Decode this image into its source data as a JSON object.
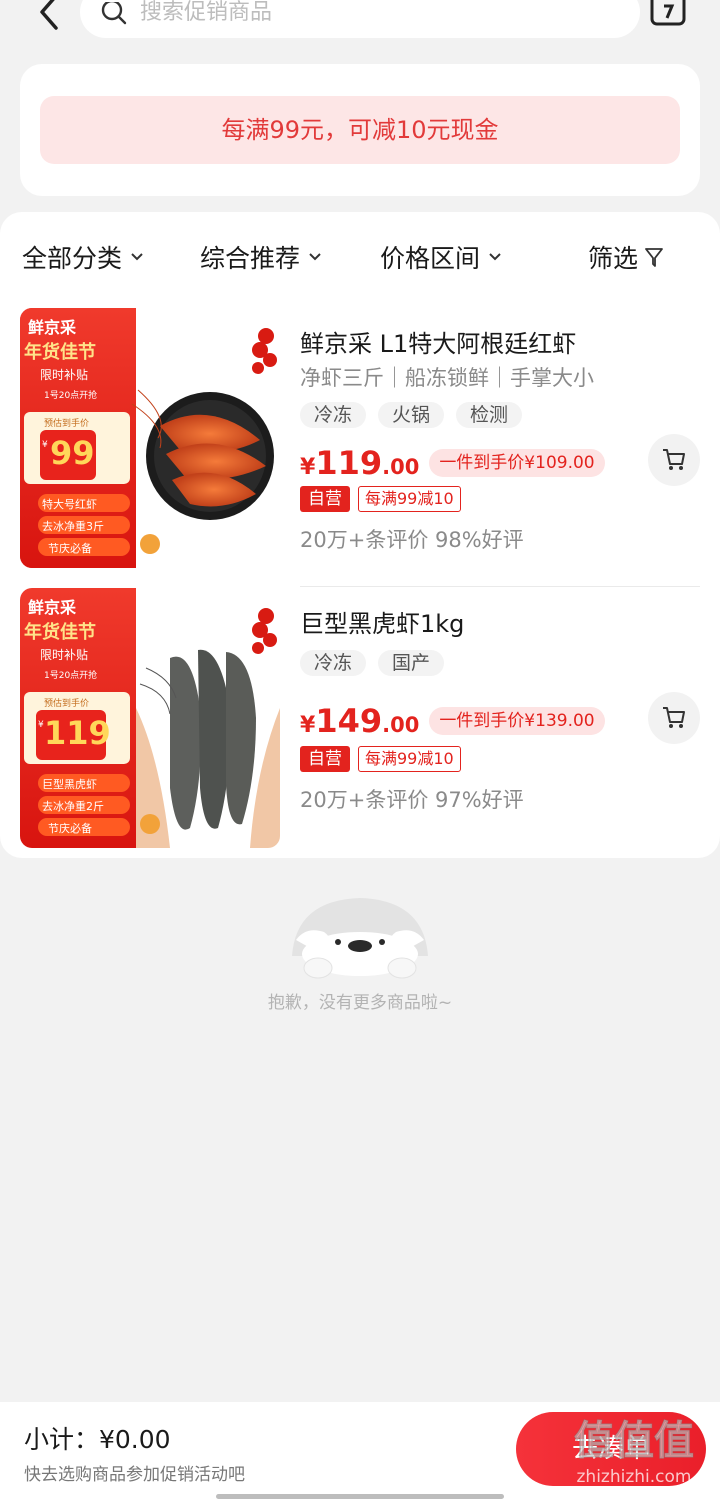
{
  "search": {
    "placeholder": "搜索促销商品"
  },
  "promo": {
    "text": "每满99元，可减10元现金"
  },
  "filters": [
    {
      "label": "全部分类",
      "icon": "chevron-down-icon"
    },
    {
      "label": "综合推荐",
      "icon": "chevron-down-icon"
    },
    {
      "label": "价格区间",
      "icon": "chevron-down-icon"
    },
    {
      "label": "筛选",
      "icon": "funnel-icon"
    }
  ],
  "products": [
    {
      "title": "鲜京采 L1特大阿根廷红虾",
      "subtitle": "净虾三斤｜船冻锁鲜｜手掌大小",
      "tags": [
        "冷冻",
        "火锅",
        "检测"
      ],
      "price_currency": "¥",
      "price_int": "119",
      "price_dec": ".00",
      "final_price": "一件到手价¥109.00",
      "badge_self": "自营",
      "badge_promo": "每满99减10",
      "reviews": "20万+条评价  98%好评",
      "thumb": {
        "brand": "鲜京采",
        "festival": "年货佳节",
        "subsidy": "限时补贴",
        "start": "1号20点开抢",
        "est_label": "预估到手价",
        "est_currency": "¥",
        "est_price": "99",
        "lines": [
          "特大号红虾",
          "去冰净重3斤",
          "节庆必备"
        ]
      }
    },
    {
      "title": "巨型黑虎虾1kg",
      "subtitle": "",
      "tags": [
        "冷冻",
        "国产"
      ],
      "price_currency": "¥",
      "price_int": "149",
      "price_dec": ".00",
      "final_price": "一件到手价¥139.00",
      "badge_self": "自营",
      "badge_promo": "每满99减10",
      "reviews": "20万+条评价  97%好评",
      "thumb": {
        "brand": "鲜京采",
        "festival": "年货佳节",
        "subsidy": "限时补贴",
        "start": "1号20点开抢",
        "est_label": "预估到手价",
        "est_currency": "¥",
        "est_price": "119",
        "lines": [
          "巨型黑虎虾",
          "去冰净重2斤",
          "节庆必备"
        ]
      }
    }
  ],
  "empty": {
    "text": "抱歉，没有更多商品啦~"
  },
  "bottom": {
    "subtotal": "小计：¥0.00",
    "hint": "快去选购商品参加促销活动吧",
    "checkout": "去凑单"
  },
  "watermark": {
    "text1": "值值值",
    "text2": "zhizhizhi.com"
  },
  "colors": {
    "accent": "#e3231e",
    "promo_bg": "#fde6e6",
    "page_bg": "#f2f2f2"
  }
}
